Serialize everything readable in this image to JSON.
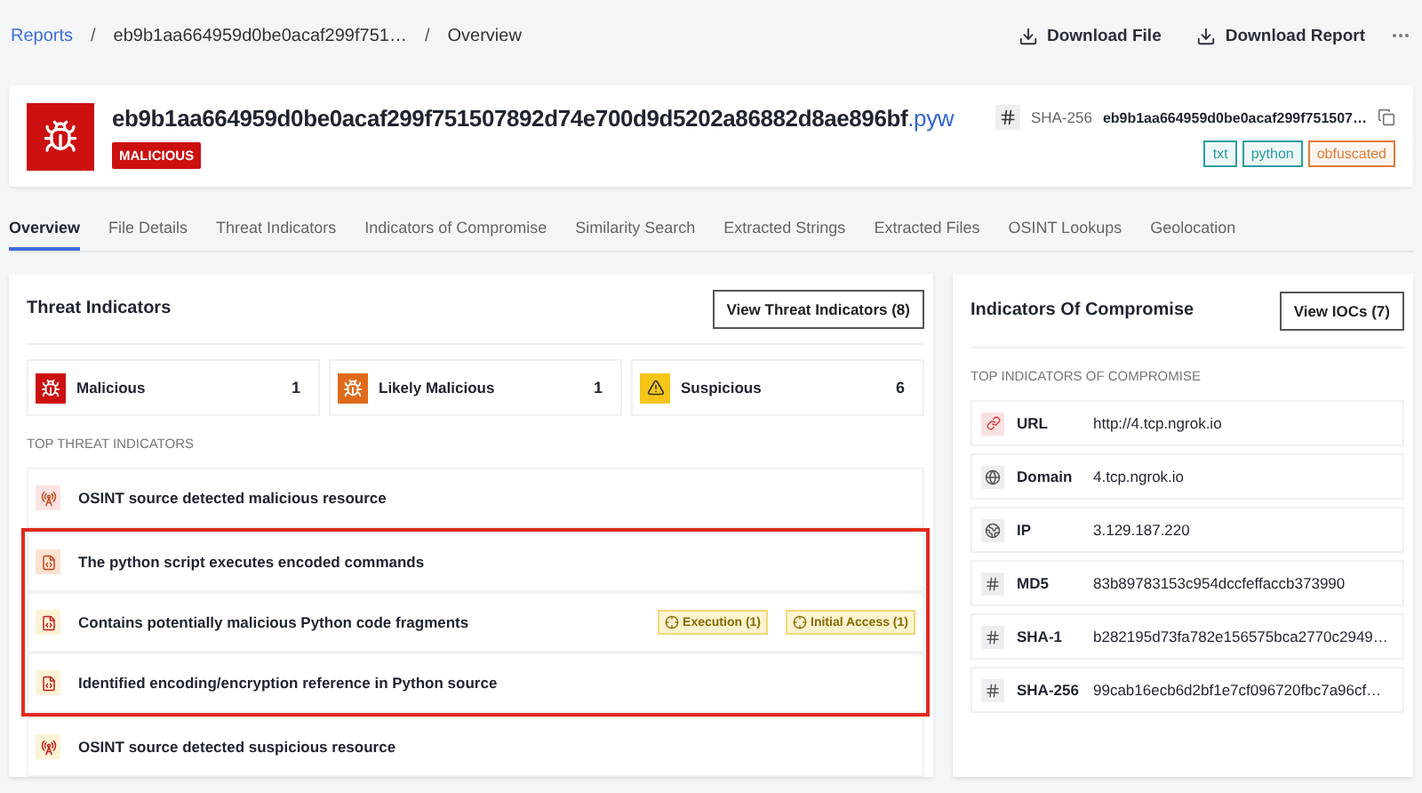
{
  "breadcrumb": [
    {
      "label": "Reports",
      "kind": "link"
    },
    {
      "label": "/",
      "kind": "separator"
    },
    {
      "label": "eb9b1aa664959d0be0acaf299f751…",
      "kind": "item"
    },
    {
      "label": "/",
      "kind": "separator"
    },
    {
      "label": "Overview",
      "kind": "item"
    }
  ],
  "actions": [
    {
      "label": "Download File"
    },
    {
      "label": "Download Report"
    }
  ],
  "file": {
    "name": "eb9b1aa664959d0be0acaf299f751507892d74e700d9d5202a86882d8ae896bf",
    "extension": ".pyw",
    "verdict": "MALICIOUS",
    "hash_label": "SHA-256",
    "hash_value": "eb9b1aa664959d0be0acaf299f751507…",
    "tags": [
      {
        "label": "txt",
        "color": "#2a9d9d"
      },
      {
        "label": "python",
        "color": "#2a9d9d"
      },
      {
        "label": "obfuscated",
        "color": "#e07b39"
      }
    ]
  },
  "tabs": [
    {
      "label": "Overview",
      "selected": true
    },
    {
      "label": "File Details",
      "selected": false
    },
    {
      "label": "Threat Indicators",
      "selected": false
    },
    {
      "label": "Indicators of Compromise",
      "selected": false
    },
    {
      "label": "Similarity Search",
      "selected": false
    },
    {
      "label": "Extracted Strings",
      "selected": false
    },
    {
      "label": "Extracted Files",
      "selected": false
    },
    {
      "label": "OSINT Lookups",
      "selected": false
    },
    {
      "label": "Geolocation",
      "selected": false
    }
  ],
  "threat_panel": {
    "title": "Threat Indicators",
    "button": "View Threat Indicators (8)",
    "stats": [
      {
        "label": "Malicious",
        "count": "1",
        "color": "#cc1010",
        "kind": "bug"
      },
      {
        "label": "Likely Malicious",
        "count": "1",
        "color": "#e06a1b",
        "kind": "bug"
      },
      {
        "label": "Suspicious",
        "count": "6",
        "color": "#f5c518",
        "kind": "warning"
      }
    ],
    "section": "TOP THREAT INDICATORS",
    "groups": [
      {
        "highlighted": false,
        "items": [
          {
            "text": "OSINT source detected malicious resource",
            "kind": "osint",
            "color": "#fbe3e3"
          }
        ]
      },
      {
        "highlighted": true,
        "items": [
          {
            "text": "The python script executes encoded commands",
            "kind": "code",
            "color": "#fbe2d3"
          },
          {
            "text": "Contains potentially malicious Python code fragments",
            "kind": "code",
            "color": "#fdf3d6",
            "tags": [
              "Execution (1)",
              "Initial Access (1)"
            ]
          },
          {
            "text": "Identified encoding/encryption reference in Python source",
            "kind": "code",
            "color": "#fdf3d6"
          }
        ]
      },
      {
        "highlighted": false,
        "items": [
          {
            "text": "OSINT source detected suspicious resource",
            "kind": "osint",
            "color": "#fdf3d6"
          }
        ]
      }
    ]
  },
  "ioc_panel": {
    "title": "Indicators Of Compromise",
    "button": "View IOCs (7)",
    "section": "TOP INDICATORS OF COMPROMISE",
    "rows": [
      {
        "type": "URL",
        "value": "http://4.tcp.ngrok.io",
        "kind": "url"
      },
      {
        "type": "Domain",
        "value": "4.tcp.ngrok.io",
        "kind": "domain"
      },
      {
        "type": "IP",
        "value": "3.129.187.220",
        "kind": "ip"
      },
      {
        "type": "MD5",
        "value": "83b89783153c954dccfeffaccb373990",
        "kind": "hash"
      },
      {
        "type": "SHA-1",
        "value": "b282195d73fa782e156575bca2770c2949…",
        "kind": "hash"
      },
      {
        "type": "SHA-256",
        "value": "99cab16ecb6d2bf1e7cf096720fbc7a96cf…",
        "kind": "hash"
      }
    ]
  }
}
